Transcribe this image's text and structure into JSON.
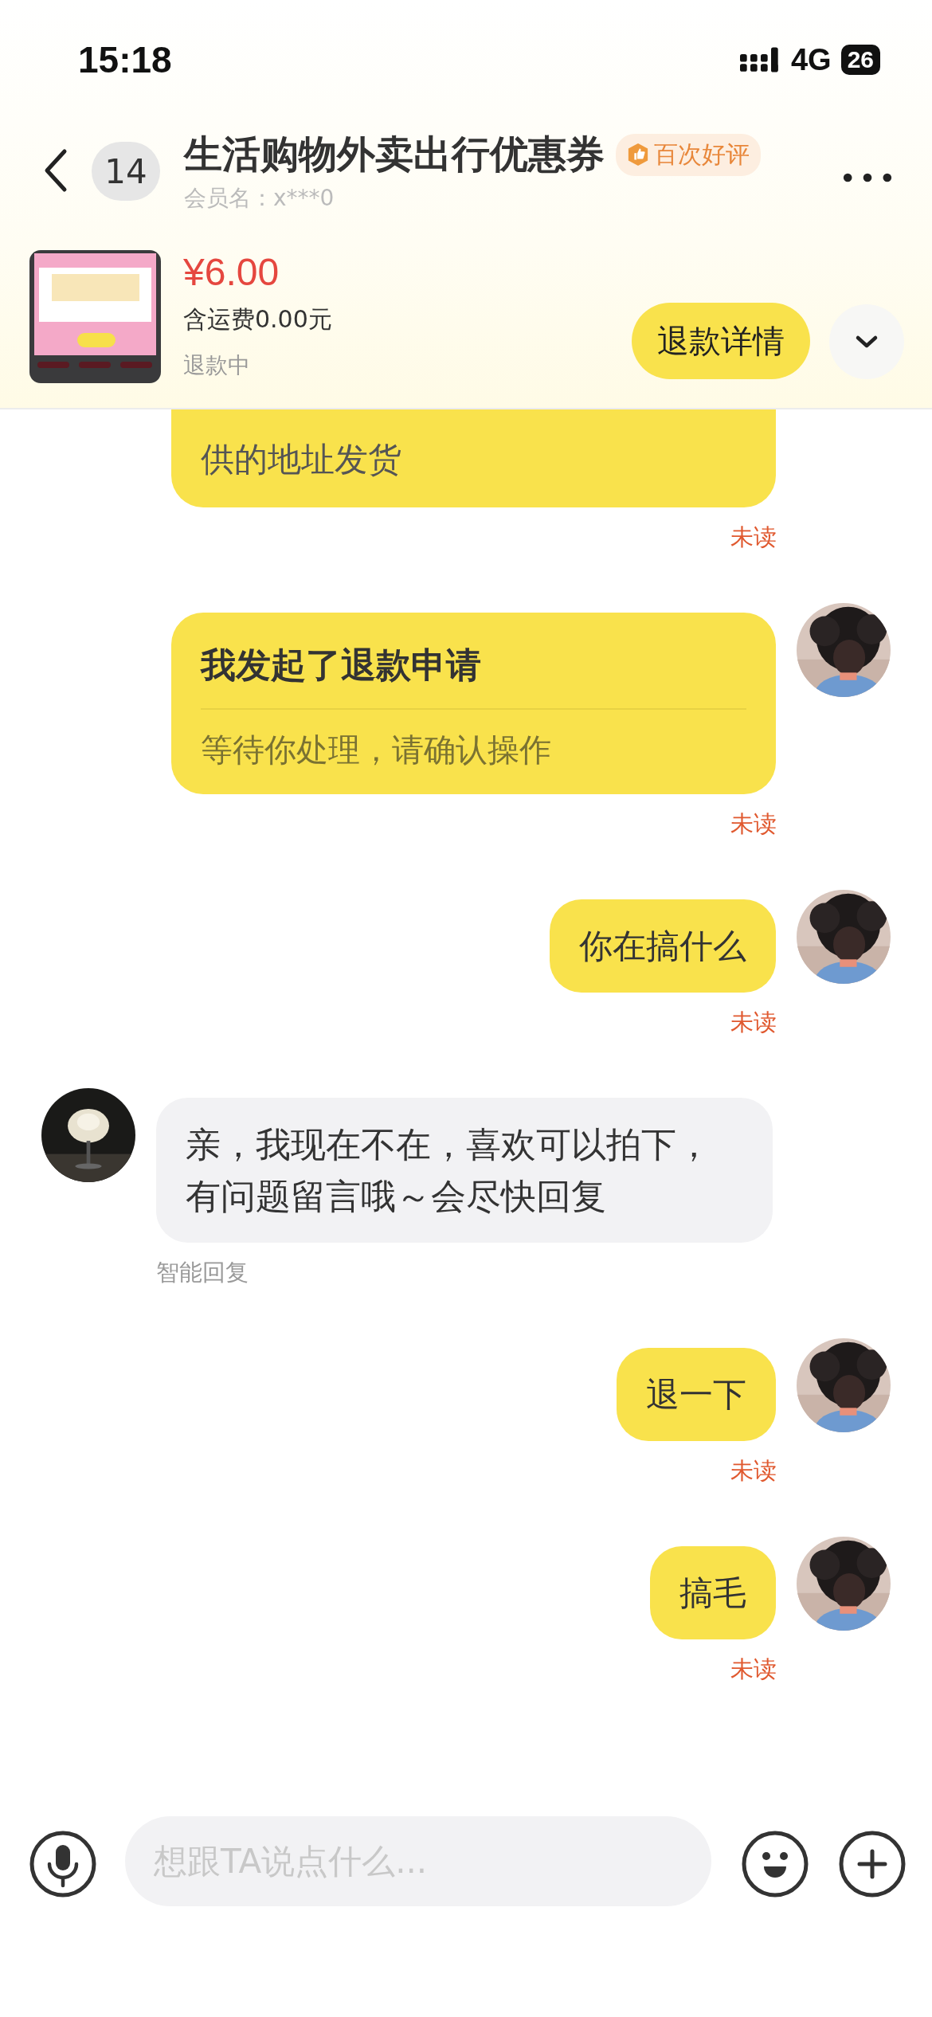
{
  "status_bar": {
    "time": "15:18",
    "network": "4G",
    "battery": "26"
  },
  "header": {
    "unread_count": "14",
    "title": "生活购物外卖出行优惠券",
    "badge": "百次好评",
    "member": "会员名：x***0"
  },
  "product": {
    "kind": "picture",
    "price": "¥6.00",
    "shipping": "含运费0.00元",
    "status": "退款中",
    "button": "退款详情"
  },
  "messages": [
    {
      "kind": "partial",
      "outgoing": true,
      "text": "供的地址发货",
      "status": "未读"
    },
    {
      "kind": "card",
      "outgoing": true,
      "title": "我发起了退款申请",
      "subtitle": "等待你处理，请确认操作",
      "status": "未读"
    },
    {
      "kind": "text",
      "outgoing": true,
      "text": "你在搞什么",
      "status": "未读"
    },
    {
      "kind": "text",
      "outgoing": false,
      "text": "亲，我现在不在，喜欢可以拍下，有问题留言哦～会尽快回复",
      "status": "智能回复"
    },
    {
      "kind": "text",
      "outgoing": true,
      "text": "退一下",
      "status": "未读"
    },
    {
      "kind": "text",
      "outgoing": true,
      "text": "搞毛",
      "status": "未读"
    }
  ],
  "input": {
    "placeholder": "想跟TA说点什么..."
  }
}
